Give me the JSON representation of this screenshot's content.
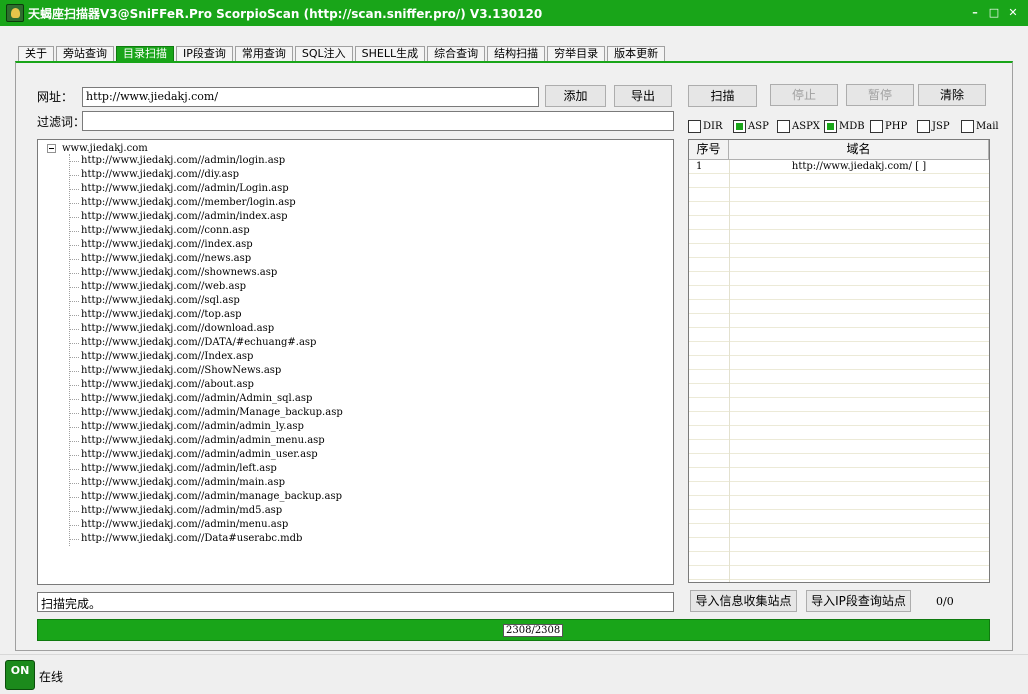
{
  "window": {
    "title": "天蝎座扫描器V3@SniFFeR.Pro  ScorpioScan (http://scan.sniffer.pro/) V3.130120",
    "minimize": "–",
    "maximize": "□",
    "close": "✕"
  },
  "tabs": [
    {
      "label": "关于"
    },
    {
      "label": "旁站查询"
    },
    {
      "label": "目录扫描",
      "active": true
    },
    {
      "label": "IP段查询"
    },
    {
      "label": "常用查询"
    },
    {
      "label": "SQL注入"
    },
    {
      "label": "SHELL生成"
    },
    {
      "label": "综合查询"
    },
    {
      "label": "结构扫描"
    },
    {
      "label": "穷举目录"
    },
    {
      "label": "版本更新"
    }
  ],
  "form": {
    "url_label": "网址：",
    "url_value": "http://www.jiedakj.com/",
    "filter_label": "过滤词：",
    "filter_value": "",
    "add_button": "添加",
    "export_button": "导出"
  },
  "actions": {
    "scan": "扫描",
    "stop": "停止",
    "pause": "暂停",
    "clear": "清除"
  },
  "filetypes": [
    {
      "label": "DIR",
      "checked": false
    },
    {
      "label": "ASP",
      "checked": true
    },
    {
      "label": "ASPX",
      "checked": false
    },
    {
      "label": "MDB",
      "checked": true
    },
    {
      "label": "PHP",
      "checked": false
    },
    {
      "label": "JSP",
      "checked": false
    },
    {
      "label": "Mail",
      "checked": false
    }
  ],
  "tree": {
    "root": "www.jiedakj.com",
    "items": [
      "http://www.jiedakj.com//admin/login.asp",
      "http://www.jiedakj.com//diy.asp",
      "http://www.jiedakj.com//admin/Login.asp",
      "http://www.jiedakj.com//member/login.asp",
      "http://www.jiedakj.com//admin/index.asp",
      "http://www.jiedakj.com//conn.asp",
      "http://www.jiedakj.com//index.asp",
      "http://www.jiedakj.com//news.asp",
      "http://www.jiedakj.com//shownews.asp",
      "http://www.jiedakj.com//web.asp",
      "http://www.jiedakj.com//sql.asp",
      "http://www.jiedakj.com//top.asp",
      "http://www.jiedakj.com//download.asp",
      "http://www.jiedakj.com//DATA/#echuang#.asp",
      "http://www.jiedakj.com//Index.asp",
      "http://www.jiedakj.com//ShowNews.asp",
      "http://www.jiedakj.com//about.asp",
      "http://www.jiedakj.com//admin/Admin_sql.asp",
      "http://www.jiedakj.com//admin/Manage_backup.asp",
      "http://www.jiedakj.com//admin/admin_ly.asp",
      "http://www.jiedakj.com//admin/admin_menu.asp",
      "http://www.jiedakj.com//admin/admin_user.asp",
      "http://www.jiedakj.com//admin/left.asp",
      "http://www.jiedakj.com//admin/main.asp",
      "http://www.jiedakj.com//admin/manage_backup.asp",
      "http://www.jiedakj.com//admin/md5.asp",
      "http://www.jiedakj.com//admin/menu.asp",
      "http://www.jiedakj.com//Data#userabc.mdb"
    ]
  },
  "sites_table": {
    "columns": [
      "序号",
      "域名"
    ],
    "rows": [
      {
        "index": "1",
        "domain": "http://www.jiedakj.com/ [ ]"
      }
    ]
  },
  "status": {
    "message": "扫描完成。",
    "import_info_button": "导入信息收集站点",
    "import_ip_button": "导入IP段查询站点",
    "count": "0/0",
    "progress_text": "2308/2308",
    "progress_fraction": 1.0,
    "online_label": "在线",
    "online_icon_text": "ON"
  },
  "colors": {
    "accent": "#19a519"
  }
}
